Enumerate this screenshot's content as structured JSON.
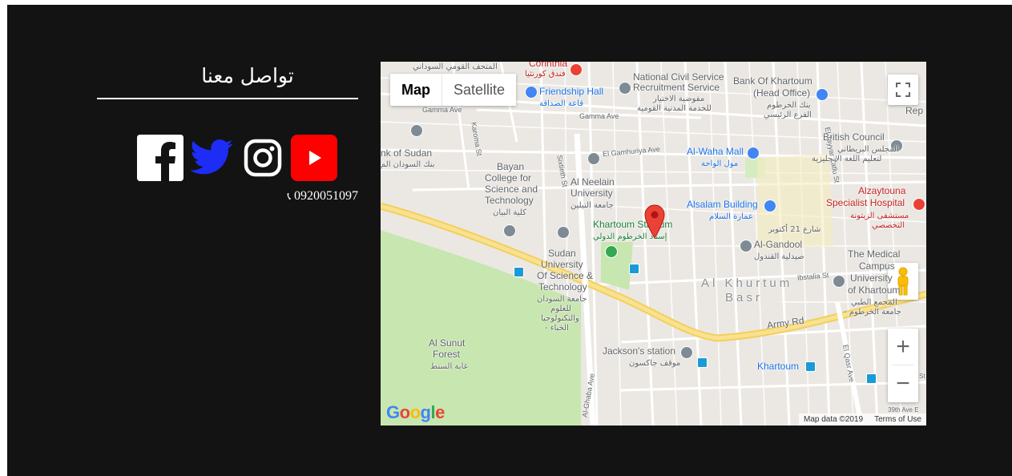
{
  "contact": {
    "title": "تواصل معنا",
    "phone": "0920051097",
    "socials": [
      {
        "name": "facebook",
        "icon": "facebook-icon",
        "color": "#ffffff"
      },
      {
        "name": "twitter",
        "icon": "twitter-icon",
        "color": "#1d2df5"
      },
      {
        "name": "instagram",
        "icon": "instagram-icon",
        "color": "#ffffff"
      },
      {
        "name": "youtube",
        "icon": "youtube-icon",
        "color": "#ff0000"
      }
    ]
  },
  "map": {
    "tabs": {
      "map": "Map",
      "satellite": "Satellite"
    },
    "zoom_in": "+",
    "zoom_out": "−",
    "google": [
      "G",
      "o",
      "o",
      "g",
      "l",
      "e"
    ],
    "attribution": {
      "data": "Map data ©2019",
      "terms": "Terms of Use"
    },
    "labels": {
      "sudan_museum": "المتحف القومي السوداني",
      "corinthia": "Corinthia",
      "corinthia_ar": "فندق كورنثيا",
      "friendship_hall": "Friendship Hall",
      "friendship_hall_ar": "قاعة الصداقة",
      "civil_service_1": "National Civil Service",
      "civil_service_2": "Recruitment Service",
      "civil_service_ar_1": "مفوضية الاختيار",
      "civil_service_ar_2": "للخدمة المدنية القومية",
      "bok_1": "Bank Of Khartoum",
      "bok_2": "(Head Office)",
      "bok_ar_1": "بنك الخرطوم",
      "bok_ar_2": "الفرع الرئيسي",
      "rep": "Rep",
      "gamma": "Gamma Ave",
      "gamma2": "Gamma Ave",
      "bank_sudan": "nk of Sudan",
      "bank_sudan_ar": "بنك السودان الم",
      "karoma": "Karoma St",
      "bayan_1": "Bayan",
      "bayan_2": "College for",
      "bayan_3": "Science and",
      "bayan_4": "Technology",
      "bayan_ar": "كلية البيان",
      "gamhuriya": "El Gamhuriya Ave",
      "sixtieth": "Sixtieth St",
      "neelain_1": "Al Neelain",
      "neelain_2": "University",
      "neelain_ar": "جامعة النيلين",
      "waha": "Al-Waha Mall",
      "waha_ar": "مول الواحة",
      "british_1": "British Council",
      "british_ar_1": "المجلس البريطاني",
      "british_ar_2": "لتعليم اللغة الإنجليزية",
      "zaytouna_1": "Alzaytouna",
      "zaytouna_2": "Specialist Hospital",
      "zaytouna_ar_1": "مستشفى الزيتونة",
      "zaytouna_ar_2": "التخصصي",
      "stadium": "Khartoum Stadium",
      "stadium_ar": "إستاد الخرطوم الدولي",
      "salam": "Alsalam Building",
      "salam_ar": "عمارة السلام",
      "tayyar": "El Tayyar Zatlu St",
      "oct21": "شارع 21 أكتوبر",
      "gandool": "Al-Gandool",
      "gandool_ar": "صيدلية القندول",
      "sust_1": "Sudan",
      "sust_2": "University",
      "sust_3": "Of Science &",
      "sust_4": "Technology",
      "sust_ar_1": "جامعة السودان",
      "sust_ar_2": "للعلوم",
      "sust_ar_3": "والتكنولوجيا",
      "sust_ar_4": "- الخباء",
      "medical_1": "The Medical",
      "medical_2": "Campus",
      "medical_3": "University",
      "medical_4": "of Khartoum",
      "medical_ar_1": "المجمع الطبي",
      "medical_ar_2": "- جامعة الخرطوم",
      "khurtum": "Al Khurtum",
      "basr": "Basr",
      "ibstalia": "Ibstalia St",
      "army": "Army Rd",
      "sunut_1": "Al Sunut",
      "sunut_2": "Forest",
      "sunut_ar": "غابة السنط",
      "jackson": "Jackson's station",
      "jackson_ar": "موقف جاكسون",
      "khartoum": "Khartoum",
      "qasr": "El Qasr Ave",
      "ghaba": "Al-Ghaba Ave",
      "thirtynine": "39th Ave E",
      "st": "St"
    }
  },
  "colors": {
    "background": "#131313",
    "map_land": "#ebe8e3",
    "map_green": "#c8e6b0",
    "road_yellow": "#f6d66e",
    "pin_red": "#ea4335"
  }
}
